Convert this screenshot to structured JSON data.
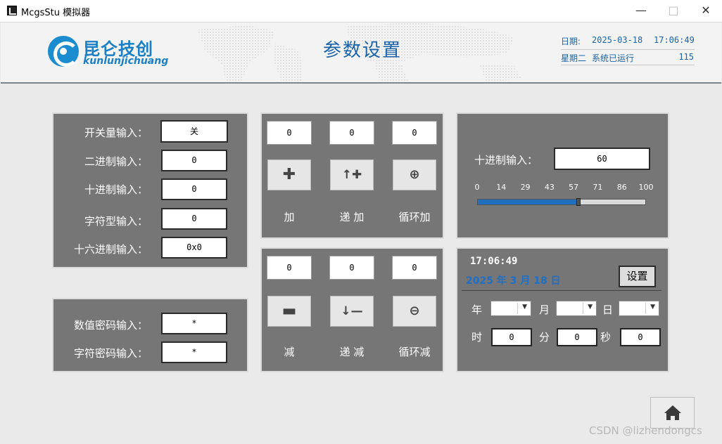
{
  "window": {
    "title": "McgsStu 模拟器"
  },
  "header": {
    "logo_cn": "昆仑技创",
    "logo_en": "kunlunjichuang",
    "title": "参数设置",
    "date_label": "日期:",
    "date": "2025-03-18",
    "time": "17:06:49",
    "weekday": "星期二",
    "running_label": "系统已运行",
    "running_value": "115"
  },
  "inputs": {
    "switch_label": "开关量输入：",
    "switch_value": "关",
    "binary_label": "二进制输入：",
    "binary_value": "0",
    "decimal_label": "十进制输入：",
    "decimal_value": "0",
    "string_label": "字符型输入：",
    "string_value": "0",
    "hex_label": "十六进制输入：",
    "hex_value": "0x0"
  },
  "passwords": {
    "numeric_label": "数值密码输入：",
    "numeric_value": "*",
    "string_label": "字符密码输入：",
    "string_value": "*"
  },
  "add_panel": {
    "values": [
      "0",
      "0",
      "0"
    ],
    "labels": [
      "加",
      "递 加",
      "循环加"
    ]
  },
  "sub_panel": {
    "values": [
      "0",
      "0",
      "0"
    ],
    "labels": [
      "减",
      "递 减",
      "循环减"
    ]
  },
  "slider_panel": {
    "label": "十进制输入：",
    "value": "60",
    "ticks": [
      "0",
      "14",
      "29",
      "43",
      "57",
      "71",
      "86",
      "100"
    ],
    "level": 60,
    "min": 0,
    "max": 100,
    "fill_color": "#1f6fbf"
  },
  "datetime_panel": {
    "time": "17:06:49",
    "date_line": "2025 年 3 月 18 日",
    "set_label": "设置",
    "year_label": "年",
    "month_label": "月",
    "day_label": "日",
    "hour_label": "时",
    "minute_label": "分",
    "second_label": "秒",
    "hour_value": "0",
    "minute_value": "0",
    "second_value": "0"
  },
  "icons": {
    "add": "plus-icon",
    "inc": "increment-icon",
    "cycle_add": "cycle-add-icon",
    "sub": "minus-icon",
    "dec": "decrement-icon",
    "cycle_sub": "cycle-sub-icon",
    "home": "home-icon"
  },
  "watermark": "CSDN @lizhendongcs"
}
